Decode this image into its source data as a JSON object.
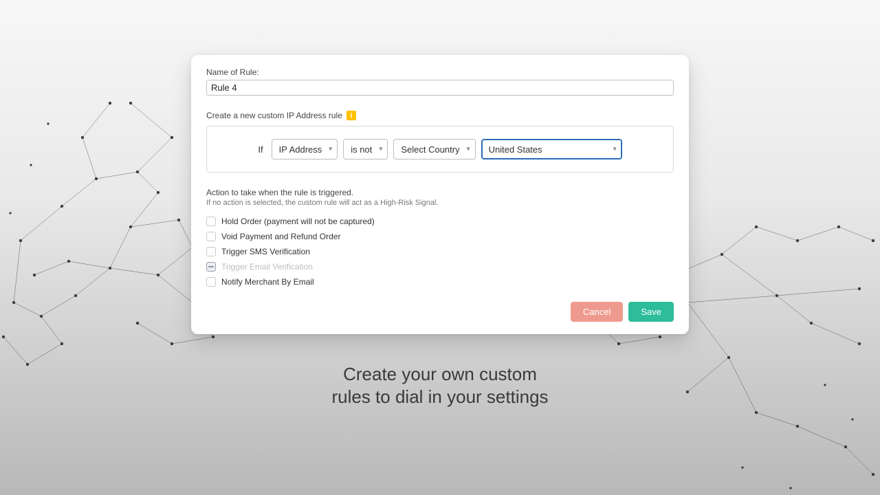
{
  "modal": {
    "name_label": "Name of Rule:",
    "name_value": "Rule 4",
    "rule_desc": "Create a new custom IP Address rule",
    "info_badge": "i",
    "builder": {
      "if_label": "If",
      "field": "IP Address",
      "operator": "is not",
      "selector_label": "Select Country",
      "value": "United States"
    },
    "action_hint": "Action to take when the rule is triggered.",
    "action_hint_sub": "If no action is selected, the custom rule will act as a High-Risk Signal.",
    "actions": [
      {
        "label": "Hold Order (payment will not be captured)",
        "state": "unchecked"
      },
      {
        "label": "Void Payment and Refund Order",
        "state": "unchecked"
      },
      {
        "label": "Trigger SMS Verification",
        "state": "unchecked"
      },
      {
        "label": "Trigger Email Verification",
        "state": "indeterminate",
        "disabled": true
      },
      {
        "label": "Notify Merchant By Email",
        "state": "unchecked"
      }
    ],
    "buttons": {
      "cancel": "Cancel",
      "save": "Save"
    }
  },
  "tagline": {
    "line1": "Create your own custom",
    "line2": "rules to dial in your settings"
  },
  "colors": {
    "accent_save": "#2dbd9b",
    "accent_cancel": "#ef9a8e",
    "info_badge": "#ffc107",
    "highlight_border": "#2b6db5"
  }
}
